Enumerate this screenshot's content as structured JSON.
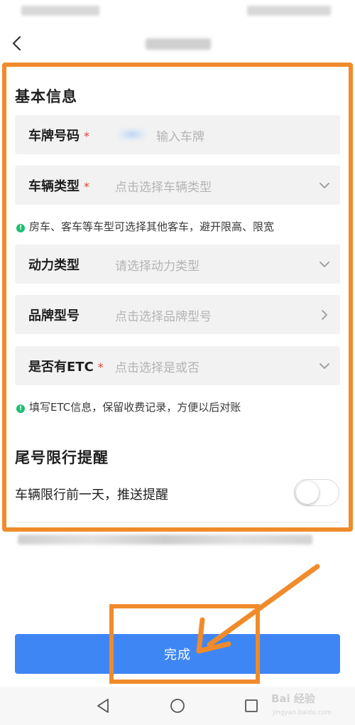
{
  "form": {
    "section_basic_title": "基本信息",
    "plate": {
      "label": "车牌号码",
      "required": "*",
      "placeholder": "输入车牌"
    },
    "vehicle_type": {
      "label": "车辆类型",
      "required": "*",
      "placeholder": "点击选择车辆类型"
    },
    "vehicle_tip": "房车、客车等车型可选择其他客车，避开限高、限宽",
    "power_type": {
      "label": "动力类型",
      "placeholder": "请选择动力类型"
    },
    "brand_model": {
      "label": "品牌型号",
      "placeholder": "点击选择品牌型号"
    },
    "etc": {
      "label": "是否有ETC",
      "required": "*",
      "placeholder": "点击选择是或否"
    },
    "etc_tip": "填写ETC信息，保留收费记录，方便以后对账",
    "section_restriction_title": "尾号限行提醒",
    "restriction_toggle_label": "车辆限行前一天，推送提醒",
    "restriction_toggle_on": false
  },
  "footer": {
    "done_label": "完成"
  },
  "watermark": {
    "text": "Bai 经验",
    "sub": "jingyan.baidu.com"
  },
  "colors": {
    "accent_blue": "#3f86f5",
    "annotation_orange": "#f08b2b",
    "required_red": "#e2423a",
    "tip_green": "#1dbf73"
  },
  "icons": {
    "back": "chevron-left-icon",
    "dropdown": "chevron-down-icon",
    "forward": "chevron-right-icon",
    "tip": "exclamation-circle-icon"
  }
}
